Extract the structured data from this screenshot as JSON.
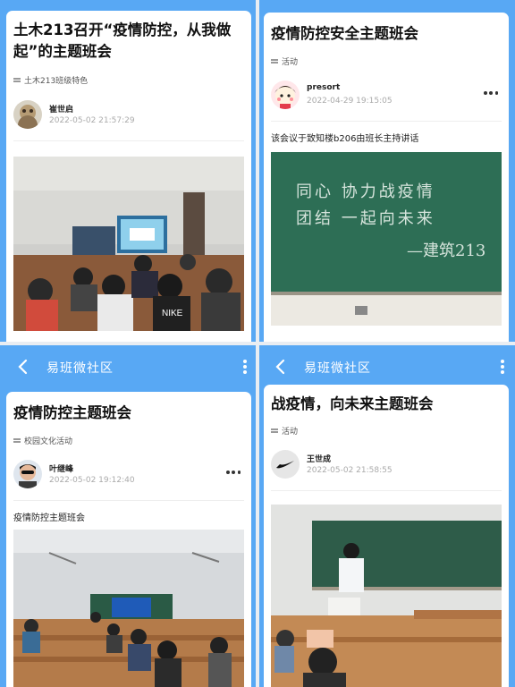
{
  "panels": [
    {
      "title": "土木213召开“疫情防控，从我做起”的主题班会",
      "tag": "土木213班级特色",
      "author": "崔世启",
      "time": "2022-05-02 21:57:29"
    },
    {
      "title": "疫情防控安全主题班会",
      "tag": "活动",
      "author": "presort",
      "time": "2022-04-29 19:15:05",
      "intro": "该会议于致知楼b206由班长主持讲话",
      "board_line1": "同心 协力战疫情",
      "board_line2": "团结 一起向未来",
      "board_sign": "—建筑213"
    },
    {
      "app_title": "易班微社区",
      "title": "疫情防控主题班会",
      "tag": "校园文化活动",
      "author": "叶继峰",
      "time": "2022-05-02 19:12:40",
      "intro": "疫情防控主题班会"
    },
    {
      "app_title": "易班微社区",
      "title": "战疫情，向未来主题班会",
      "tag": "活动",
      "author": "王世成",
      "time": "2022-05-02 21:58:55"
    }
  ],
  "colors": {
    "accent": "#58a8f4",
    "board": "#2d6e55"
  },
  "icons": [
    "back-arrow-icon",
    "more-vertical-icon",
    "more-horizontal-icon",
    "tag-icon"
  ]
}
